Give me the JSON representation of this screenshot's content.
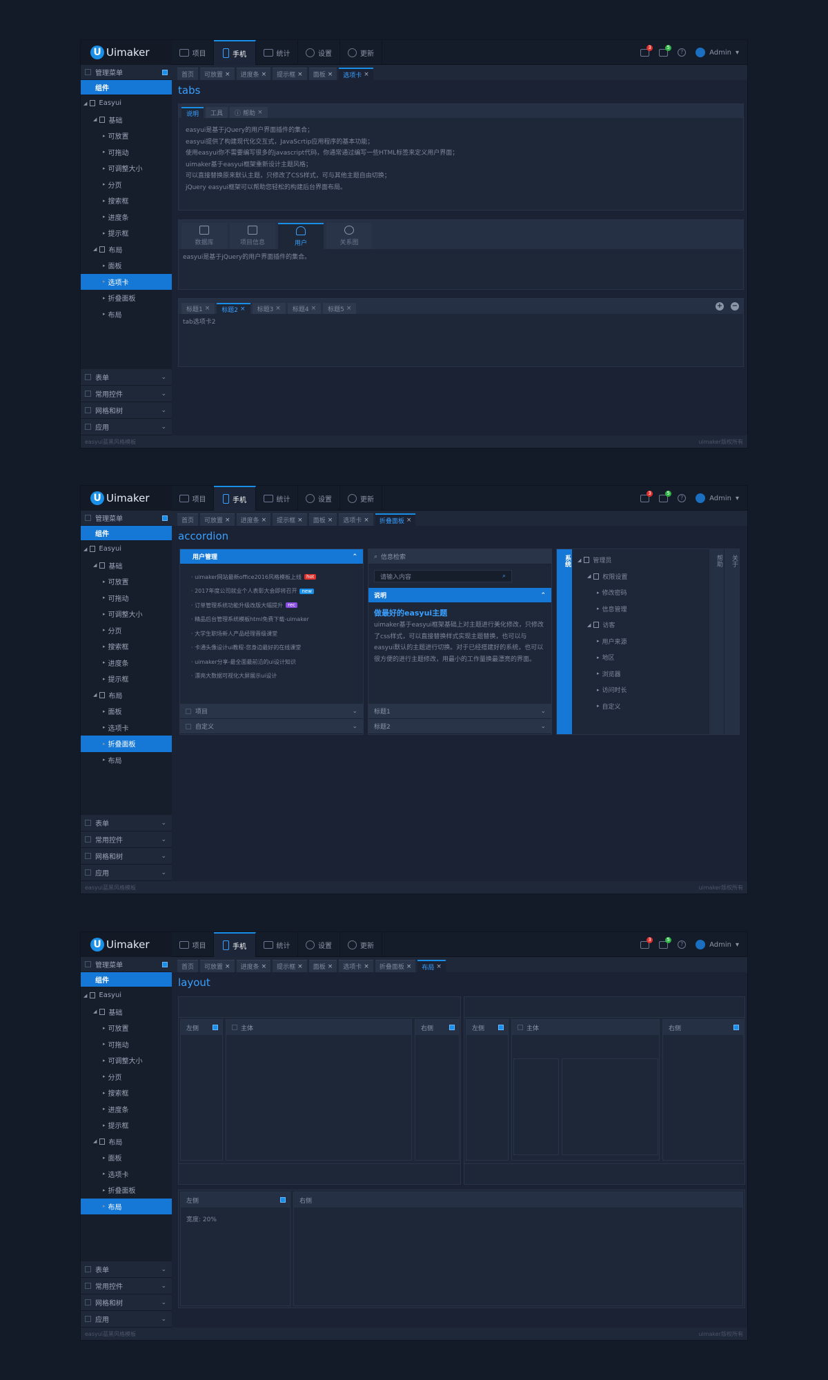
{
  "app": {
    "logo": "Uimaker",
    "user": "Admin",
    "footer_left": "easyui蓝黑风格模板",
    "footer_right": "uimaker版权所有"
  },
  "topnav": [
    "项目",
    "手机",
    "统计",
    "设置",
    "更新"
  ],
  "badges": {
    "msg": "3",
    "mail": "5"
  },
  "sidebar": {
    "header": "管理菜单",
    "group": "组件",
    "tree": [
      {
        "level": 0,
        "label": "Easyui",
        "type": "folder"
      },
      {
        "level": 1,
        "label": "基础",
        "type": "folder"
      },
      {
        "level": 2,
        "label": "可放置",
        "type": "leaf"
      },
      {
        "level": 2,
        "label": "可拖动",
        "type": "leaf"
      },
      {
        "level": 2,
        "label": "可调整大小",
        "type": "leaf"
      },
      {
        "level": 2,
        "label": "分页",
        "type": "leaf"
      },
      {
        "level": 2,
        "label": "搜索框",
        "type": "leaf"
      },
      {
        "level": 2,
        "label": "进度条",
        "type": "leaf"
      },
      {
        "level": 2,
        "label": "提示框",
        "type": "leaf"
      },
      {
        "level": 1,
        "label": "布局",
        "type": "folder"
      },
      {
        "level": 2,
        "label": "面板",
        "type": "leaf"
      },
      {
        "level": 2,
        "label": "选项卡",
        "type": "leaf"
      },
      {
        "level": 2,
        "label": "折叠面板",
        "type": "leaf"
      },
      {
        "level": 2,
        "label": "布局",
        "type": "leaf"
      }
    ],
    "bottom": [
      "表单",
      "常用控件",
      "网格和树",
      "应用"
    ]
  },
  "pagetabs": [
    "首页",
    "可放置",
    "进度条",
    "提示框",
    "面板",
    "选项卡",
    "折叠面板",
    "布局"
  ],
  "screen1": {
    "title": "tabs",
    "tabs1": [
      "说明",
      "工具",
      "帮助"
    ],
    "lines": [
      "easyui是基于jQuery的用户界面插件的集合；",
      "easyui提供了构建现代化交互式，JavaScrtip应用程序的基本功能；",
      "使用easyui你不需要编写很多的javascript代码，你通常通过编写一些HTML标签来定义用户界面；",
      "uimaker基于easyui框架重新设计主题风格；",
      "可以直接替换原来默认主题，只修改了CSS样式，可与其他主题自由切换；",
      "jQuery easyui框架可以帮助您轻松的构建后台界面布局。"
    ],
    "bigtabs": [
      "数据库",
      "项目信息",
      "用户",
      "关系图"
    ],
    "bigtext": "easyui是基于jQuery的用户界面插件的集合。",
    "tabs3": [
      "标题1",
      "标题2",
      "标题3",
      "标题4",
      "标题5"
    ],
    "tab3text": "tab选项卡2"
  },
  "screen2": {
    "title": "accordion",
    "acc1_head": "用户管理",
    "news": [
      {
        "t": "uimaker网站最新office2016风格模板上线",
        "tag": "hot",
        "c": "#e0302c"
      },
      {
        "t": "2017年度公司就业个人表彰大会即将召开",
        "tag": "new",
        "c": "#1a8fe8"
      },
      {
        "t": "订单管理系统功能升级改版大幅提升",
        "tag": "rec",
        "c": "#8a4ce0"
      },
      {
        "t": "精品后台管理系统模板html免费下载-uimaker",
        "tag": "",
        "c": ""
      },
      {
        "t": "大学生职场新人产品经理晋级课堂",
        "tag": "",
        "c": ""
      },
      {
        "t": "卡通头像设计ui教程-您身边最好的在线课堂",
        "tag": "",
        "c": ""
      },
      {
        "t": "uimaker分享-最全面最前沿的ui设计知识",
        "tag": "",
        "c": ""
      },
      {
        "t": "漂亮大数据可视化大屏展示ui设计",
        "tag": "",
        "c": ""
      }
    ],
    "acc1_bottom": [
      "项目",
      "自定义"
    ],
    "search_head": "信息检索",
    "search_ph": "请输入内容",
    "desc_head": "说明",
    "desc_title": "做最好的easyui主题",
    "desc_text": "uimaker基于easyui框架基础上对主题进行美化修改，只修改了css样式，可以直接替换样式实现主题替换，也可以与easyui默认的主题进行切换。对于已经搭建好的系统，也可以很方便的进行主题修改，用最小的工作量换最漂亮的界面。",
    "acc2_bottom": [
      "标题1",
      "标题2"
    ],
    "vtab": "系统",
    "vtabs_right": [
      "帮助",
      "关于"
    ],
    "tree": [
      {
        "level": 0,
        "label": "管理员",
        "type": "folder"
      },
      {
        "level": 1,
        "label": "权限设置",
        "type": "folder"
      },
      {
        "level": 2,
        "label": "修改密码",
        "type": "leaf"
      },
      {
        "level": 2,
        "label": "信息管理",
        "type": "leaf"
      },
      {
        "level": 1,
        "label": "访客",
        "type": "folder"
      },
      {
        "level": 2,
        "label": "用户来源",
        "type": "leaf"
      },
      {
        "level": 2,
        "label": "地区",
        "type": "leaf"
      },
      {
        "level": 2,
        "label": "浏览器",
        "type": "leaf"
      },
      {
        "level": 2,
        "label": "访问时长",
        "type": "leaf"
      },
      {
        "level": 2,
        "label": "自定义",
        "type": "leaf"
      }
    ]
  },
  "screen3": {
    "title": "layout",
    "left": "左侧",
    "main": "主体",
    "right": "右侧",
    "width_text": "宽度: 20%"
  }
}
